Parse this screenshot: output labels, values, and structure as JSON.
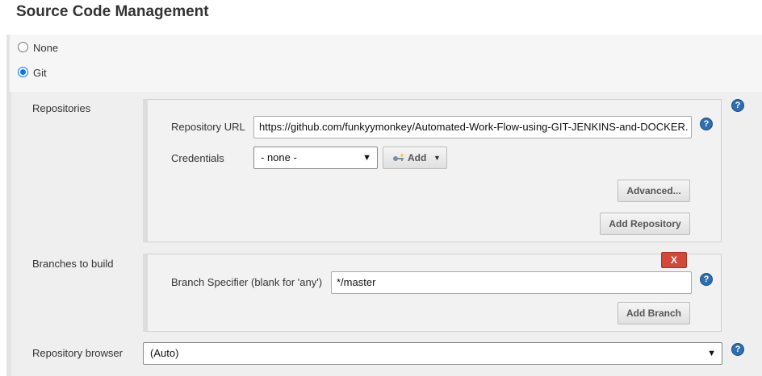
{
  "section_title": "Source Code Management",
  "scm_options": [
    {
      "label": "None",
      "checked": false
    },
    {
      "label": "Git",
      "checked": true
    }
  ],
  "repositories": {
    "label": "Repositories",
    "url_label": "Repository URL",
    "url_value": "https://github.com/funkyymonkey/Automated-Work-Flow-using-GIT-JENKINS-and-DOCKER.",
    "credentials_label": "Credentials",
    "credentials_value": "- none -",
    "add_label": "Add",
    "advanced_label": "Advanced...",
    "add_repository_label": "Add Repository"
  },
  "branches": {
    "label": "Branches to build",
    "delete_label": "X",
    "specifier_label": "Branch Specifier (blank for 'any')",
    "specifier_value": "*/master",
    "add_branch_label": "Add Branch"
  },
  "repository_browser": {
    "label": "Repository browser",
    "value": "(Auto)"
  },
  "help_glyph": "?",
  "colors": {
    "accent": "#0075ff",
    "help": "#2f6fae",
    "delete": "#d24939"
  }
}
